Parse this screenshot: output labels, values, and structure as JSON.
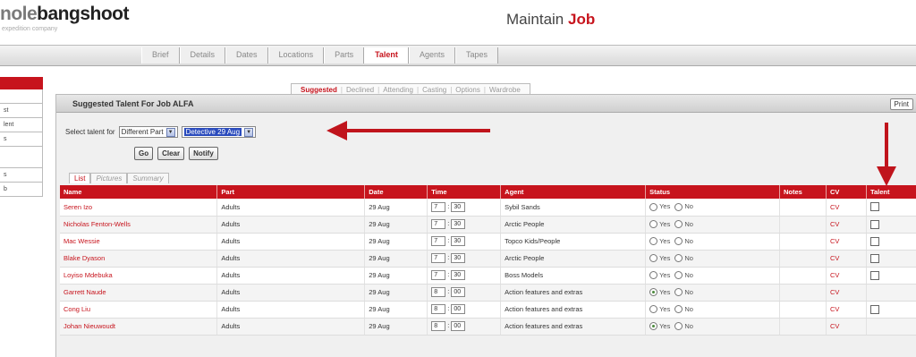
{
  "logo": {
    "prefix": "nole",
    "brand": "bangshoot",
    "sub": "expedition company"
  },
  "page_title": {
    "prefix": "Maintain",
    "highlight": "Job"
  },
  "main_tabs": [
    "Brief",
    "Details",
    "Dates",
    "Locations",
    "Parts",
    "Talent",
    "Agents",
    "Tapes"
  ],
  "main_tabs_active": "Talent",
  "sidebar": {
    "items": [
      "",
      "st",
      "lent",
      "s",
      "",
      "s",
      "b"
    ]
  },
  "sub_tabs": [
    "Suggested",
    "Declined",
    "Attending",
    "Casting",
    "Options",
    "Wardrobe"
  ],
  "panel": {
    "title": "Suggested Talent For Job ALFA",
    "print_label": "Print"
  },
  "select_row": {
    "label": "Select talent for",
    "part_value": "Different Part",
    "date_value": "Detective 29 Aug"
  },
  "buttons": {
    "go": "Go",
    "clear": "Clear",
    "notify": "Notify"
  },
  "view_tabs": [
    "List",
    "Pictures",
    "Summary"
  ],
  "table": {
    "headers": [
      "Name",
      "Part",
      "Date",
      "Time",
      "Agent",
      "Status",
      "Notes",
      "CV",
      "Talent"
    ],
    "status_yes": "Yes",
    "status_no": "No",
    "rows": [
      {
        "name": "Seren Izo",
        "part": "Adults",
        "date": "29 Aug",
        "hour": "7",
        "min": "30",
        "agent": "Sybil Sands",
        "status": "",
        "cv": "CV",
        "talent": true
      },
      {
        "name": "Nicholas Fenton-Wells",
        "part": "Adults",
        "date": "29 Aug",
        "hour": "7",
        "min": "30",
        "agent": "Arctic People",
        "status": "",
        "cv": "CV",
        "talent": true
      },
      {
        "name": "Mac Wessie",
        "part": "Adults",
        "date": "29 Aug",
        "hour": "7",
        "min": "30",
        "agent": "Topco Kids/People",
        "status": "",
        "cv": "CV",
        "talent": true
      },
      {
        "name": "Blake Dyason",
        "part": "Adults",
        "date": "29 Aug",
        "hour": "7",
        "min": "30",
        "agent": "Arctic People",
        "status": "",
        "cv": "CV",
        "talent": true
      },
      {
        "name": "Loyiso Mdebuka",
        "part": "Adults",
        "date": "29 Aug",
        "hour": "7",
        "min": "30",
        "agent": "Boss Models",
        "status": "",
        "cv": "CV",
        "talent": true
      },
      {
        "name": "Garrett Naude",
        "part": "Adults",
        "date": "29 Aug",
        "hour": "8",
        "min": "00",
        "agent": "Action features and extras",
        "status": "yes",
        "cv": "CV",
        "talent": false
      },
      {
        "name": "Cong Liu",
        "part": "Adults",
        "date": "29 Aug",
        "hour": "8",
        "min": "00",
        "agent": "Action features and extras",
        "status": "",
        "cv": "CV",
        "talent": true
      },
      {
        "name": "Johan Nieuwoudt",
        "part": "Adults",
        "date": "29 Aug",
        "hour": "8",
        "min": "00",
        "agent": "Action features and extras",
        "status": "yes",
        "cv": "CV",
        "talent": false
      }
    ]
  },
  "colors": {
    "accent": "#c7141d",
    "arrow": "#c0141c"
  }
}
